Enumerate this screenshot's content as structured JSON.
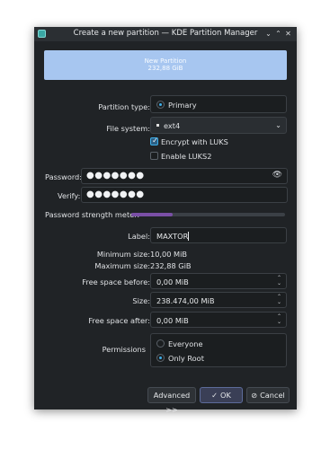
{
  "window": {
    "title": "Create a new partition — KDE Partition Manager"
  },
  "titlebar_buttons": {
    "minimize": "⌄",
    "maximize": "⌃",
    "close": "✕"
  },
  "preview": {
    "name": "New Partition",
    "size": "232,88 GiB"
  },
  "partition_type": {
    "label": "Partition type:",
    "value": "Primary"
  },
  "file_system": {
    "label": "File system:",
    "value": "ext4"
  },
  "encrypt": {
    "label": "Encrypt with LUKS",
    "checked": true
  },
  "luks2": {
    "label": "Enable LUKS2",
    "checked": false
  },
  "password": {
    "label": "Password:",
    "value": "●●●●●●●"
  },
  "verify": {
    "label": "Verify:",
    "value": "●●●●●●●"
  },
  "strength": {
    "label": "Password strength meter:",
    "level": 0.27,
    "color": "#7a4fa6"
  },
  "label_field": {
    "label": "Label:",
    "value": "MAXTOR"
  },
  "min_size": {
    "label": "Minimum size:",
    "value": "10,00 MiB"
  },
  "max_size": {
    "label": "Maximum size:",
    "value": "232,88 GiB"
  },
  "free_before": {
    "label": "Free space before:",
    "value": "0,00 MiB"
  },
  "size": {
    "label": "Size:",
    "value": "238.474,00 MiB"
  },
  "free_after": {
    "label": "Free space after:",
    "value": "0,00 MiB"
  },
  "permissions": {
    "label": "Permissions",
    "options": [
      "Everyone",
      "Only Root"
    ],
    "selected": "Only Root"
  },
  "buttons": {
    "advanced": "Advanced >>",
    "ok": "OK",
    "cancel": "Cancel"
  },
  "colors": {
    "accent": "#3daee9",
    "preview": "#a7c6f0"
  },
  "icons": {
    "eye": "eye-icon",
    "ok": "check-icon",
    "cancel": "cancel-icon",
    "app": "partition-manager-icon"
  }
}
